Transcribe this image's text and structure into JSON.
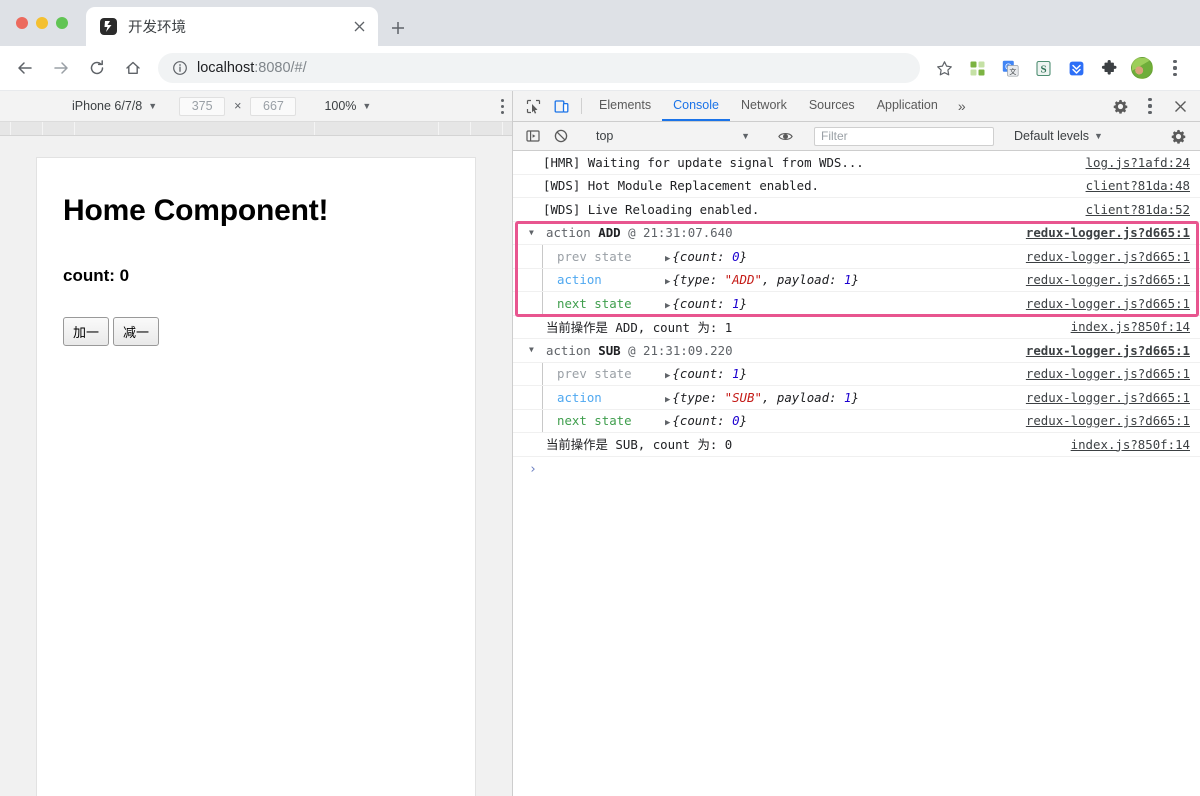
{
  "browser": {
    "tab": {
      "title": "开发环境",
      "favicon": "site-favicon",
      "close": "×"
    },
    "new_tab": "+",
    "url_host": "localhost",
    "url_path": ":8080/#/",
    "toolbar_icons": [
      "bookmark-star-icon",
      "grid-apps-icon",
      "google-translate-icon",
      "s-extension-icon",
      "download-extension-icon",
      "puzzle-extensions-icon",
      "profile-avatar",
      "chrome-menu-icon"
    ]
  },
  "device_toolbar": {
    "device": "iPhone 6/7/8",
    "width": "375",
    "height": "667",
    "x_label": "×",
    "zoom": "100%",
    "menu": "more-options"
  },
  "page": {
    "heading": "Home Component!",
    "count_label": "count: 0",
    "buttons": [
      {
        "label": "加一",
        "name": "increment-button"
      },
      {
        "label": "减一",
        "name": "decrement-button"
      }
    ]
  },
  "devtools": {
    "tabs": [
      "Elements",
      "Console",
      "Network",
      "Sources",
      "Application"
    ],
    "selected_tab": "Console",
    "more": "»",
    "filter_bar": {
      "context": "top",
      "filter_placeholder": "Filter",
      "levels": "Default levels"
    },
    "prompt": "›",
    "highlight_color": "#e8558f",
    "messages": [
      {
        "kind": "plain",
        "text": "[HMR] Waiting for update signal from WDS...",
        "src": "log.js?1afd:24"
      },
      {
        "kind": "plain",
        "text": "[WDS] Hot Module Replacement enabled.",
        "src": "client?81da:48"
      },
      {
        "kind": "plain",
        "text": "[WDS] Live Reloading enabled.",
        "src": "client?81da:52"
      },
      {
        "kind": "group",
        "pre": "action",
        "action": "ADD",
        "at": "@ 21:31:07.640",
        "src": "redux-logger.js?d665:1"
      },
      {
        "kind": "state",
        "label": "prev state",
        "style": "prev",
        "open": "{",
        "key": "count: ",
        "val": "0",
        "vtype": "num",
        "close": "}",
        "src": "redux-logger.js?d665:1"
      },
      {
        "kind": "action",
        "label": "action",
        "style": "act",
        "open": "{",
        "key": "type: ",
        "val": "\"ADD\"",
        "vtype": "str",
        "key2": ", payload: ",
        "val2": "1",
        "close": "}",
        "src": "redux-logger.js?d665:1"
      },
      {
        "kind": "state",
        "label": "next state",
        "style": "next",
        "open": "{",
        "key": "count: ",
        "val": "1",
        "vtype": "num",
        "close": "}",
        "src": "redux-logger.js?d665:1"
      },
      {
        "kind": "plain2",
        "text": "当前操作是 ADD, count 为: 1",
        "src": "index.js?850f:14"
      },
      {
        "kind": "group",
        "pre": "action",
        "action": "SUB",
        "at": "@ 21:31:09.220",
        "src": "redux-logger.js?d665:1"
      },
      {
        "kind": "state",
        "label": "prev state",
        "style": "prev",
        "open": "{",
        "key": "count: ",
        "val": "1",
        "vtype": "num",
        "close": "}",
        "src": "redux-logger.js?d665:1"
      },
      {
        "kind": "action",
        "label": "action",
        "style": "act",
        "open": "{",
        "key": "type: ",
        "val": "\"SUB\"",
        "vtype": "str",
        "key2": ", payload: ",
        "val2": "1",
        "close": "}",
        "src": "redux-logger.js?d665:1"
      },
      {
        "kind": "state",
        "label": "next state",
        "style": "next",
        "open": "{",
        "key": "count: ",
        "val": "0",
        "vtype": "num",
        "close": "}",
        "src": "redux-logger.js?d665:1"
      },
      {
        "kind": "plain2",
        "text": "当前操作是 SUB, count 为: 0",
        "src": "index.js?850f:14"
      }
    ]
  }
}
